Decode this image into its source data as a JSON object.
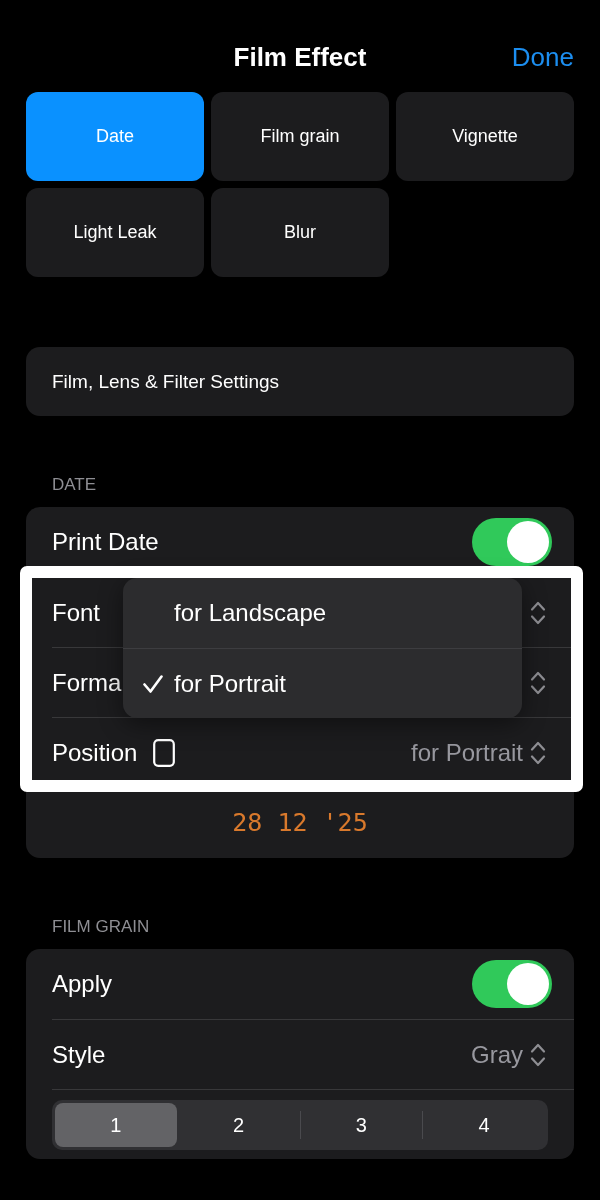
{
  "header": {
    "title": "Film Effect",
    "done": "Done"
  },
  "effects": [
    {
      "label": "Date",
      "selected": true
    },
    {
      "label": "Film grain",
      "selected": false
    },
    {
      "label": "Vignette",
      "selected": false
    },
    {
      "label": "Light Leak",
      "selected": false
    },
    {
      "label": "Blur",
      "selected": false
    }
  ],
  "settings_link": {
    "label": "Film, Lens & Filter Settings"
  },
  "sections": [
    {
      "title": "DATE",
      "rows": [
        {
          "kind": "toggle",
          "label": "Print Date",
          "on": true,
          "highlighted": false
        },
        {
          "kind": "picker",
          "label": "Font",
          "highlighted": true
        },
        {
          "kind": "picker",
          "label": "Forma",
          "highlighted": true
        },
        {
          "kind": "orientation_picker",
          "label": "Position",
          "value": "for Portrait",
          "highlighted": true,
          "menu": {
            "options": [
              {
                "label": "for Landscape",
                "selected": false
              },
              {
                "label": "for Portrait",
                "selected": true
              }
            ]
          }
        },
        {
          "kind": "preview",
          "text": "28 12 '25",
          "highlighted": false
        }
      ]
    },
    {
      "title": "FILM GRAIN",
      "rows": [
        {
          "kind": "toggle",
          "label": "Apply",
          "on": true,
          "highlighted": false
        },
        {
          "kind": "picker",
          "label": "Style",
          "value": "Gray",
          "highlighted": false
        },
        {
          "kind": "segmented",
          "highlighted": false,
          "segments": [
            {
              "label": "1",
              "selected": true
            },
            {
              "label": "2",
              "selected": false
            },
            {
              "label": "3",
              "selected": false
            },
            {
              "label": "4",
              "selected": false
            }
          ]
        }
      ]
    }
  ]
}
